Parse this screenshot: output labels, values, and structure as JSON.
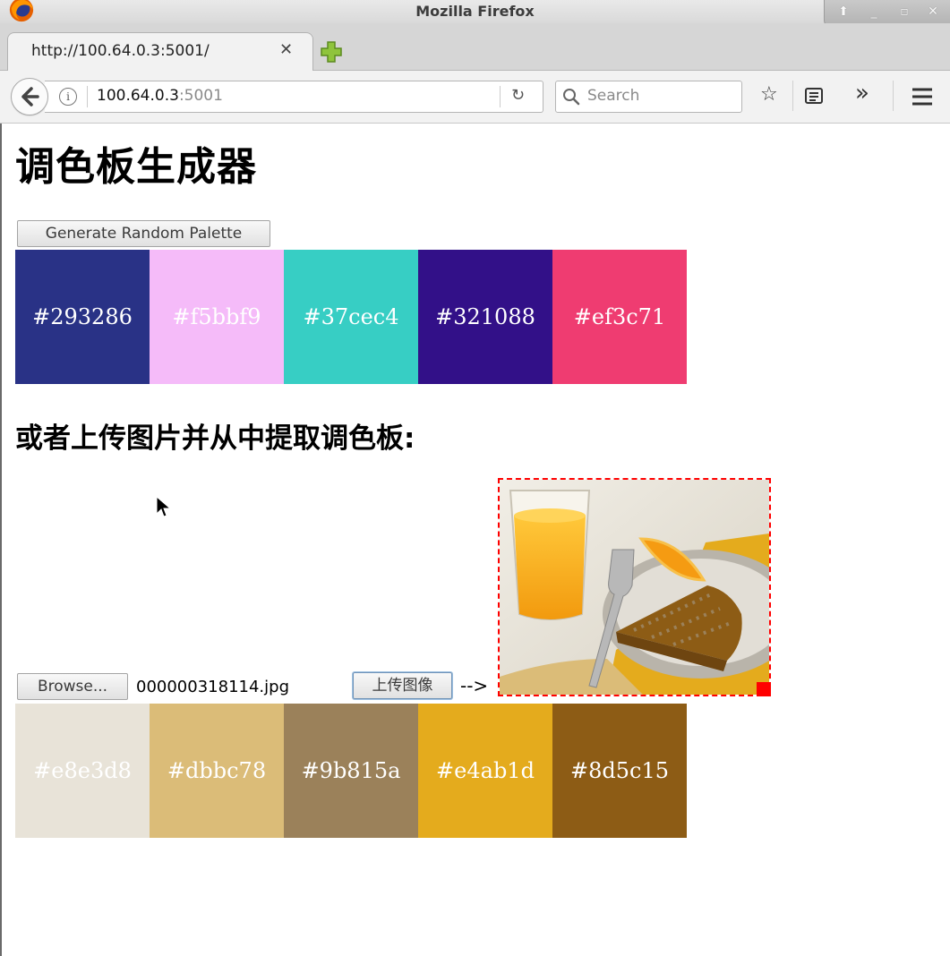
{
  "window": {
    "title": "Mozilla Firefox"
  },
  "tab": {
    "title": "http://100.64.0.3:5001/",
    "close_glyph": "✕"
  },
  "navbar": {
    "url_host": "100.64.0.3",
    "url_port": ":5001",
    "search_placeholder": "Search",
    "overflow_glyph": "»"
  },
  "page": {
    "title": "调色板生成器",
    "random_button_label": "Generate Random Palette",
    "upload_heading": "或者上传图片并从中提取调色板:",
    "browse_button_label": "Browse...",
    "selected_file": "000000318114.jpg",
    "upload_button_label": "上传图像",
    "arrow_text": "-->"
  },
  "random_palette": [
    {
      "hex": "#293286",
      "label": "#293286"
    },
    {
      "hex": "#f5bbf9",
      "label": "#f5bbf9"
    },
    {
      "hex": "#37cec4",
      "label": "#37cec4"
    },
    {
      "hex": "#321088",
      "label": "#321088"
    },
    {
      "hex": "#ef3c71",
      "label": "#ef3c71"
    }
  ],
  "image_palette": [
    {
      "hex": "#e8e3d8",
      "label": "#e8e3d8"
    },
    {
      "hex": "#dbbc78",
      "label": "#dbbc78"
    },
    {
      "hex": "#9b815a",
      "label": "#9b815a"
    },
    {
      "hex": "#e4ab1d",
      "label": "#e4ab1d"
    },
    {
      "hex": "#8d5c15",
      "label": "#8d5c15"
    }
  ],
  "colors": {
    "preview_border": "#ff0000"
  }
}
